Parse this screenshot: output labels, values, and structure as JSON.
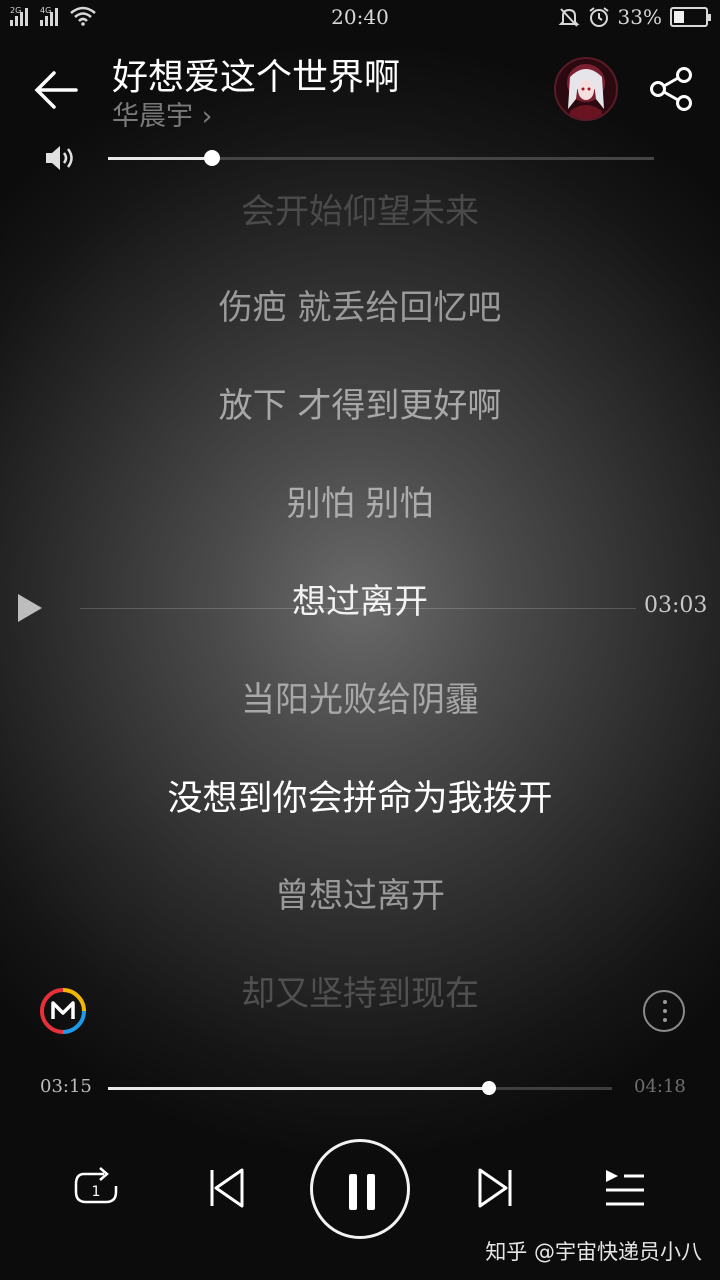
{
  "status_bar": {
    "net1": "2G",
    "net2": "4G",
    "time": "20:40",
    "battery_text": "33%",
    "battery_level": 0.33
  },
  "header": {
    "title": "好想爱这个世界啊",
    "artist": "华晨宇 ›"
  },
  "volume": {
    "level": 0.19
  },
  "lyrics": [
    {
      "text": "会开始仰望未来",
      "color": "#4a4a4a"
    },
    {
      "text": "伤疤 就丢给回忆吧",
      "color": "#9a9a9a"
    },
    {
      "text": "放下 才得到更好啊",
      "color": "#a8a8a8"
    },
    {
      "text": "别怕 别怕",
      "color": "#acacac"
    },
    {
      "text": "想过离开",
      "color": "#f2f2f2"
    },
    {
      "text": "当阳光败给阴霾",
      "color": "#a8a8a8"
    },
    {
      "text": "没想到你会拼命为我拨开",
      "color": "#ffffff"
    },
    {
      "text": "曾想过离开",
      "color": "#9a9a9a"
    },
    {
      "text": "却又坚持到现在",
      "color": "#505050"
    }
  ],
  "seek_marker": {
    "time": "03:03"
  },
  "playback": {
    "current_time": "03:15",
    "total_time": "04:18",
    "progress": 0.755,
    "repeat_badge": "1"
  },
  "watermark": "知乎 @宇宙快递员小八",
  "colors": {
    "accent": "#ffffff",
    "muted": "#7a7a7a"
  }
}
